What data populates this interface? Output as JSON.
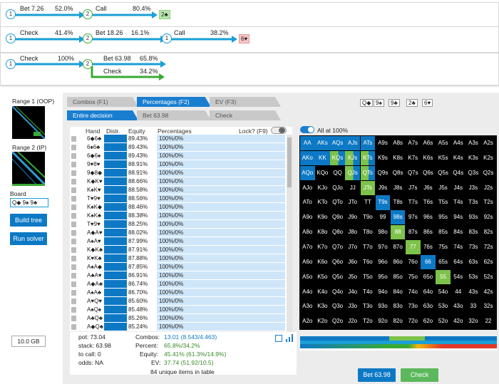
{
  "colors": {
    "bet": "#0d79c5",
    "check": "#7dc24a",
    "accent": "#1a9fd6"
  },
  "trees": [
    {
      "n1": "1",
      "a1": "Bet 7.26",
      "p1": "52.0%",
      "n2": "2",
      "a2": "Call",
      "p2": "80.4%",
      "card": "2♣"
    },
    {
      "n1": "1",
      "a1": "Check",
      "p1": "41.4%",
      "n2": "2",
      "a2": "Bet 18.26",
      "p2": "16.1%",
      "n3": "1",
      "a3": "Call",
      "p3": "38.2%",
      "card": "6♥"
    },
    {
      "n1": "1",
      "a1": "Check",
      "p1": "100%",
      "n2": "2",
      "a2": "Bet 63.98",
      "p2": "65.8%",
      "a2b": "Check",
      "p2b": "34.2%"
    }
  ],
  "left": {
    "range1": "Range 1 (OOP)",
    "range2": "Range 2 (IP)",
    "board_label": "Board",
    "board_value": "Q◆ 9♠ 9♣",
    "build_tree": "Build tree",
    "run_solver": "Run solver",
    "memory": "10.0 GB"
  },
  "tabs": {
    "t1": "Combos (F1)",
    "t2": "Percentages (F2)",
    "t3": "EV (F3)",
    "s1": "Entire decision",
    "s2": "Bet 63.98",
    "s3": "Check"
  },
  "board_chips": [
    "Q◆",
    "9♠",
    "9♣",
    "2♣",
    "6♥"
  ],
  "table": {
    "headers": {
      "hand": "Hand",
      "distr": "Distr.",
      "equity": "Equity",
      "pcts": "Percentages",
      "lock": "Lock? (F9)"
    },
    "rows": [
      [
        "6◆6♣",
        "89.43%",
        "100%/0%"
      ],
      [
        "6♠6♣",
        "89.43%",
        "100%/0%"
      ],
      [
        "6◆6♠",
        "89.43%",
        "100%/0%"
      ],
      [
        "9♥8♥",
        "88.91%",
        "100%/0%"
      ],
      [
        "9◆8◆",
        "88.91%",
        "100%/0%"
      ],
      [
        "K◆K♥",
        "88.66%",
        "100%/0%"
      ],
      [
        "K♠K♥",
        "88.58%",
        "100%/0%"
      ],
      [
        "T♥9♥",
        "88.56%",
        "100%/0%"
      ],
      [
        "K♠K◆",
        "88.46%",
        "100%/0%"
      ],
      [
        "K♠K♣",
        "88.38%",
        "100%/0%"
      ],
      [
        "T♥9♥",
        "88.25%",
        "100%/0%"
      ],
      [
        "A◆A♥",
        "88.02%",
        "100%/0%"
      ],
      [
        "A♠A♥",
        "87.99%",
        "100%/0%"
      ],
      [
        "K◆K♣",
        "87.91%",
        "100%/0%"
      ],
      [
        "K♥K♣",
        "87.88%",
        "100%/0%"
      ],
      [
        "A♠A◆",
        "87.85%",
        "100%/0%"
      ],
      [
        "A♣A♥",
        "86.91%",
        "100%/0%"
      ],
      [
        "A◆A♣",
        "86.74%",
        "100%/0%"
      ],
      [
        "A♠A♣",
        "86.70%",
        "100%/0%"
      ],
      [
        "A♥Q♥",
        "85.60%",
        "100%/0%"
      ],
      [
        "A♠Q♠",
        "85.48%",
        "100%/0%"
      ],
      [
        "A♣Q♣",
        "85.26%",
        "100%/0%"
      ],
      [
        "A◆Q♣",
        "85.24%",
        "100%/0%"
      ]
    ]
  },
  "stats": {
    "pot": "pot: 73.04",
    "stack": "stack: 63.98",
    "tocall": "to call: 0",
    "odds": "odds: NA",
    "combos_l": "Combos:",
    "combos": "13.01 (8.543/4.463)",
    "percent_l": "Percent:",
    "percent": "65.8%/34.2%",
    "equity_l": "Equity:",
    "equity": "45.41% (61.3%/14.9%)",
    "ev_l": "EV:",
    "ev": "37.74 (51.92/10.5)",
    "unique": "84 unique items in table"
  },
  "grid_toggle": "All at 100%",
  "grid": [
    [
      "AA",
      "AKs",
      "AQs",
      "AJs",
      "ATs",
      "A9s",
      "A8s",
      "A7s",
      "A6s",
      "A5s",
      "A4s",
      "A3s",
      "A2s"
    ],
    [
      "AKo",
      "KK",
      "KQs",
      "KJs",
      "KTs",
      "K9s",
      "K8s",
      "K7s",
      "K6s",
      "K5s",
      "K4s",
      "K3s",
      "K2s"
    ],
    [
      "AQo",
      "KQo",
      "QQ",
      "QJs",
      "QTs",
      "Q9s",
      "Q8s",
      "Q7s",
      "Q6s",
      "Q5s",
      "Q4s",
      "Q3s",
      "Q2s"
    ],
    [
      "AJo",
      "KJo",
      "QJo",
      "JJ",
      "JTs",
      "J9s",
      "J8s",
      "J7s",
      "J6s",
      "J5s",
      "J4s",
      "J3s",
      "J2s"
    ],
    [
      "ATo",
      "KTo",
      "QTo",
      "JTo",
      "TT",
      "T9s",
      "T8s",
      "T7s",
      "T6s",
      "T5s",
      "T4s",
      "T3s",
      "T2s"
    ],
    [
      "A9o",
      "K9o",
      "Q9o",
      "J9o",
      "T9o",
      "99",
      "98s",
      "97s",
      "96s",
      "95s",
      "94s",
      "93s",
      "92s"
    ],
    [
      "A8o",
      "K8o",
      "Q8o",
      "J8o",
      "T8o",
      "98o",
      "88",
      "87s",
      "86s",
      "85s",
      "84s",
      "83s",
      "82s"
    ],
    [
      "A7o",
      "K7o",
      "Q7o",
      "J7o",
      "T7o",
      "97o",
      "87o",
      "77",
      "76s",
      "75s",
      "74s",
      "73s",
      "72s"
    ],
    [
      "A6o",
      "K6o",
      "Q6o",
      "J6o",
      "T6o",
      "96o",
      "86o",
      "76o",
      "66",
      "65s",
      "64s",
      "63s",
      "62s"
    ],
    [
      "A5o",
      "K5o",
      "Q5o",
      "J5o",
      "T5o",
      "95o",
      "85o",
      "75o",
      "65o",
      "55",
      "54s",
      "53s",
      "52s"
    ],
    [
      "A4o",
      "K4o",
      "Q4o",
      "J4o",
      "T4o",
      "94o",
      "84o",
      "74o",
      "64o",
      "54o",
      "44",
      "43s",
      "42s"
    ],
    [
      "A3o",
      "K3o",
      "Q3o",
      "J3o",
      "T3o",
      "93o",
      "83o",
      "73o",
      "63o",
      "53o",
      "43o",
      "33",
      "32s"
    ],
    [
      "A2o",
      "K2o",
      "Q2o",
      "J2o",
      "T2o",
      "92o",
      "82o",
      "72o",
      "62o",
      "52o",
      "42o",
      "32o",
      "22"
    ]
  ],
  "actions": {
    "bet": "Bet 63.98",
    "check": "Check"
  }
}
